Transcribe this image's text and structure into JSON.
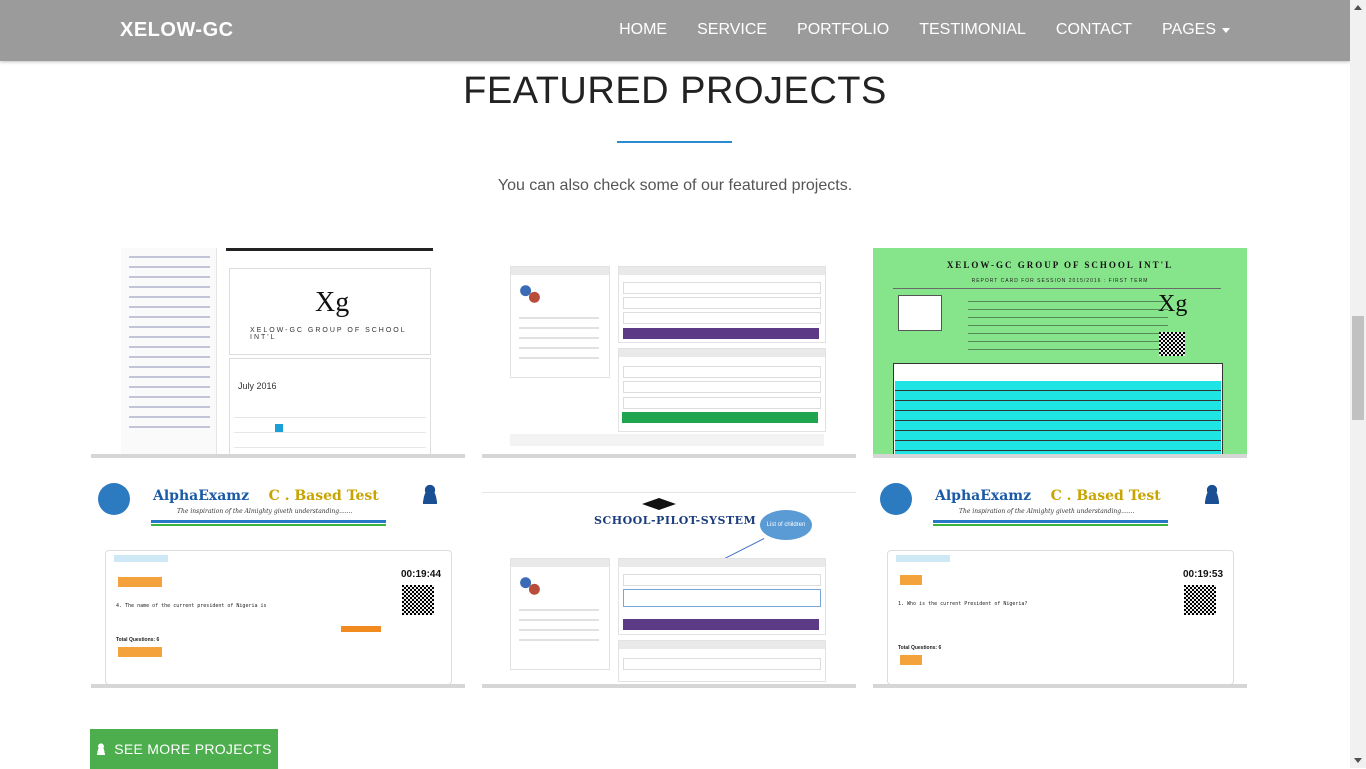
{
  "navbar": {
    "brand": "XELOW-GC",
    "items": [
      {
        "label": "HOME"
      },
      {
        "label": "SERVICE"
      },
      {
        "label": "PORTFOLIO"
      },
      {
        "label": "TESTIMONIAL"
      },
      {
        "label": "CONTACT"
      },
      {
        "label": "PAGES"
      }
    ]
  },
  "section": {
    "title": "FEATURED PROJECTS",
    "subtitle": "You can also check some of our featured projects.",
    "accent_color": "#2a8bd1"
  },
  "projects": {
    "dashboard": {
      "logo": "Xg",
      "school_name": "XELOW-GC GROUP OF SCHOOL INT'L",
      "month": "July 2016"
    },
    "report_card": {
      "title": "XELOW-GC GROUP OF SCHOOL INT'L",
      "subtitle": "REPORT CARD FOR SESSION 2015/2016 : FIRST TERM",
      "logo": "Xg",
      "bg_color": "#86e58a"
    },
    "alpha_left": {
      "brand_a": "AlphaExamz",
      "brand_b": "C . Based Test",
      "tagline": "The inspiration of the Almighty giveth understanding.......",
      "timer": "00:19:44",
      "question": "4. The name of the current president of Nigeria is",
      "total": "Total Questions: 6"
    },
    "school_pilot": {
      "logo": "SCHOOL-PILOT-SYSTEM",
      "bubble": "List of children"
    },
    "alpha_right": {
      "brand_a": "AlphaExamz",
      "brand_b": "C . Based Test",
      "tagline": "The inspiration of the Almighty giveth understanding.......",
      "timer": "00:19:53",
      "question": "1. Who is the current President of Nigeria?",
      "total": "Total Questions: 6"
    }
  },
  "cta": {
    "label": "SEE MORE PROJECTS",
    "color": "#4cae4c"
  },
  "icons": {
    "caret": "chevron-down-icon",
    "cta": "user-icon"
  }
}
